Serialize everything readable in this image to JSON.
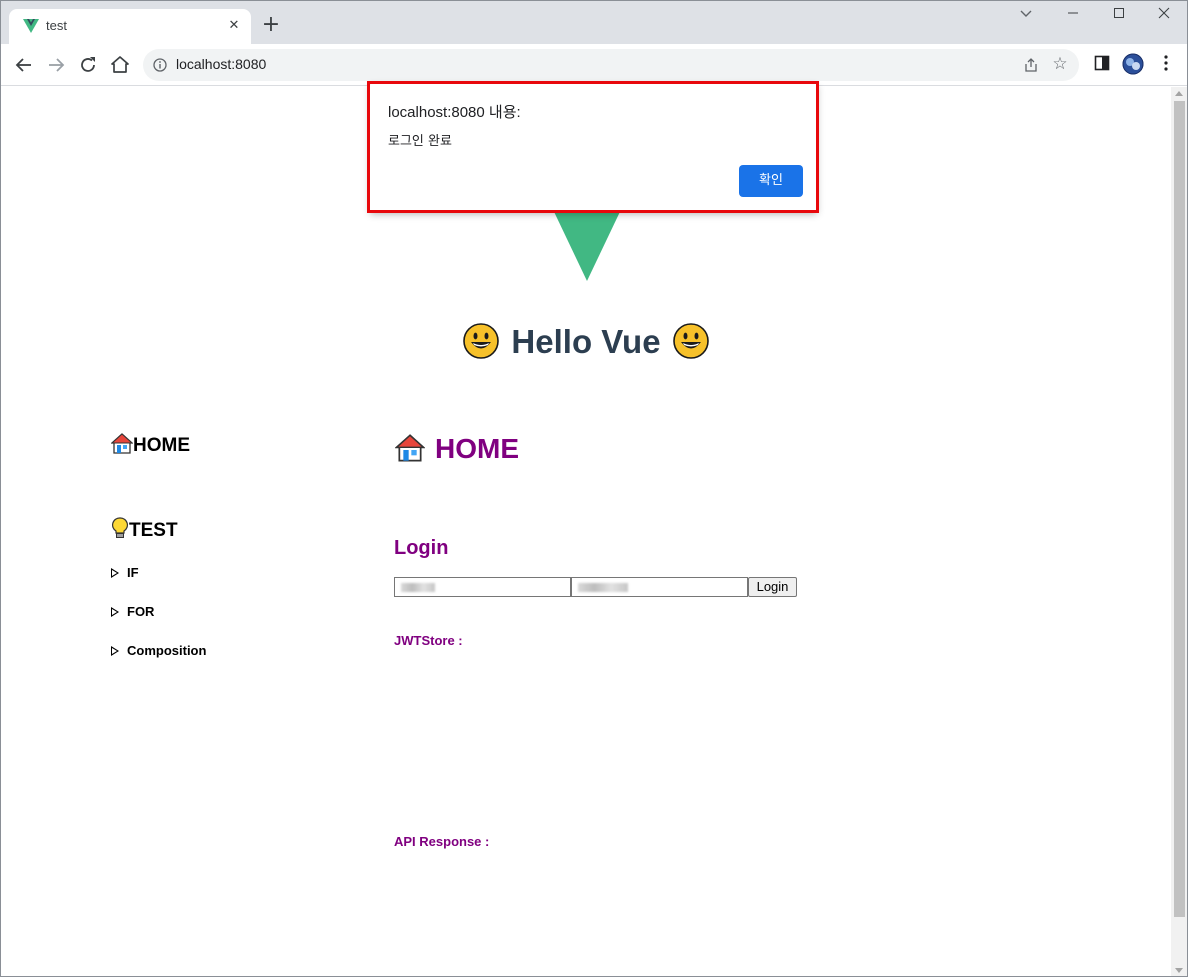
{
  "browser": {
    "tab": {
      "title": "test",
      "close_glyph": "✕"
    },
    "new_tab_glyph": "+",
    "window_controls": {
      "chevron": "⌄",
      "minimize": "—",
      "maximize": "☐",
      "close": "✕"
    },
    "omnibox": {
      "url": "localhost:8080"
    },
    "accent": "#1a73e8"
  },
  "page": {
    "hello": {
      "text": "Hello Vue",
      "color": "#2c3e50"
    },
    "sidebar": {
      "home_label": "HOME",
      "test_label": "TEST",
      "links": [
        {
          "label": "IF"
        },
        {
          "label": "FOR"
        },
        {
          "label": "Composition"
        }
      ]
    },
    "main": {
      "home_title": "HOME",
      "title_color": "#800080",
      "login": {
        "title": "Login",
        "button_label": "Login"
      },
      "jwt_label": "JWTStore :",
      "api_label": "API Response :"
    },
    "vue_logo_color": "#41b883"
  },
  "dialog": {
    "title": "localhost:8080 내용:",
    "message": "로그인 완료",
    "ok_label": "확인",
    "highlight_color": "#e8080c"
  }
}
